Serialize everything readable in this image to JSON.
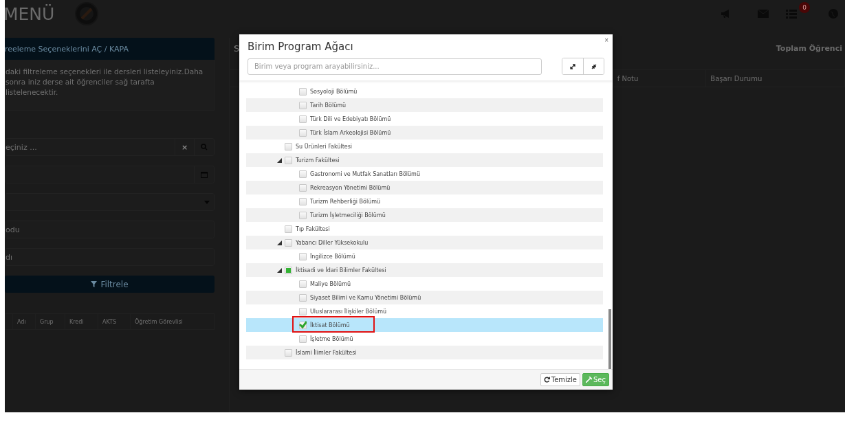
{
  "topbar": {
    "title": "MENÜ",
    "notification_count": "0"
  },
  "filter_panel": {
    "toggle": "reeleme Seçeneklerini AÇ / KAPA",
    "description": "daki filtreleme seçenekleri ile dersleri listeleyiniz.Daha sonra iniz derse ait öğrenciler sağ tarafta listelenecektir.",
    "fields": [
      {
        "kind": "search",
        "placeholder": "eçiniz ...",
        "clear": "×"
      },
      {
        "kind": "date"
      },
      {
        "kind": "select"
      },
      {
        "kind": "text",
        "placeholder": "odu"
      },
      {
        "kind": "text",
        "placeholder": "dı"
      }
    ],
    "button": "Filtrele",
    "columns": [
      "Adı",
      "Grup",
      "Kredi",
      "AKTS",
      "Öğretim Görevlisi"
    ]
  },
  "results": {
    "title": "S",
    "total": "Toplam Öğrenci",
    "columns": [
      "f Notu",
      "Başarı Durumu"
    ]
  },
  "modal": {
    "title": "Birim Program Ağacı",
    "close": "×",
    "search": {
      "placeholder": "Birim veya program arayabilirsiniz..."
    },
    "tree": [
      {
        "children": [
          {
            "label": "Sosyoloji Bölümü",
            "checked": false,
            "partial": false,
            "selected": false,
            "outlined": false
          },
          {
            "label": "Tarih Bölümü",
            "checked": false,
            "partial": false,
            "selected": false,
            "outlined": false
          },
          {
            "label": "Türk Dili ve Edebiyatı Bölümü",
            "checked": false,
            "partial": false,
            "selected": false,
            "outlined": false
          },
          {
            "label": "Türk İslam Arkeolojisi Bölümü",
            "checked": false,
            "partial": false,
            "selected": false,
            "outlined": false
          }
        ]
      },
      {
        "label": "Su Ürünleri Fakültesi",
        "checked": false,
        "partial": false,
        "selected": false,
        "outlined": false
      },
      {
        "label": "Turizm Fakültesi",
        "expanded": true,
        "checked": false,
        "partial": false,
        "selected": false,
        "outlined": false,
        "children": [
          {
            "label": "Gastronomi ve Mutfak Sanatları Bölümü",
            "checked": false,
            "partial": false,
            "selected": false,
            "outlined": false
          },
          {
            "label": "Rekreasyon Yönetimi Bölümü",
            "checked": false,
            "partial": false,
            "selected": false,
            "outlined": false
          },
          {
            "label": "Turizm Rehberliği Bölümü",
            "checked": false,
            "partial": false,
            "selected": false,
            "outlined": false
          },
          {
            "label": "Turizm İşletmeciliği Bölümü",
            "checked": false,
            "partial": false,
            "selected": false,
            "outlined": false
          }
        ]
      },
      {
        "label": "Tıp Fakültesi",
        "checked": false,
        "partial": false,
        "selected": false,
        "outlined": false
      },
      {
        "label": "Yabancı Diller Yüksekokulu",
        "expanded": true,
        "checked": false,
        "partial": false,
        "selected": false,
        "outlined": false,
        "children": [
          {
            "label": "İngilizce Bölümü",
            "checked": false,
            "partial": false,
            "selected": false,
            "outlined": false
          }
        ]
      },
      {
        "label": "İktisadi ve İdari Bilimler Fakültesi",
        "expanded": true,
        "checked": false,
        "partial": true,
        "selected": false,
        "outlined": false,
        "children": [
          {
            "label": "Maliye Bölümü",
            "checked": false,
            "partial": false,
            "selected": false,
            "outlined": false
          },
          {
            "label": "Siyaset Bilimi ve Kamu Yönetimi Bölümü",
            "checked": false,
            "partial": false,
            "selected": false,
            "outlined": false
          },
          {
            "label": "Uluslararası İlişkiler Bölümü",
            "checked": false,
            "partial": false,
            "selected": false,
            "outlined": false
          },
          {
            "label": "İktisat Bölümü",
            "checked": true,
            "partial": false,
            "selected": true,
            "outlined": true
          },
          {
            "label": "İşletme Bölümü",
            "checked": false,
            "partial": false,
            "selected": false,
            "outlined": false
          }
        ]
      },
      {
        "label": "İslami İlimler Fakültesi",
        "checked": false,
        "partial": false,
        "selected": false,
        "outlined": false
      }
    ],
    "buttons": [
      {
        "kind": "clear",
        "label": "Temizle"
      },
      {
        "kind": "select",
        "label": "Seç"
      }
    ]
  }
}
